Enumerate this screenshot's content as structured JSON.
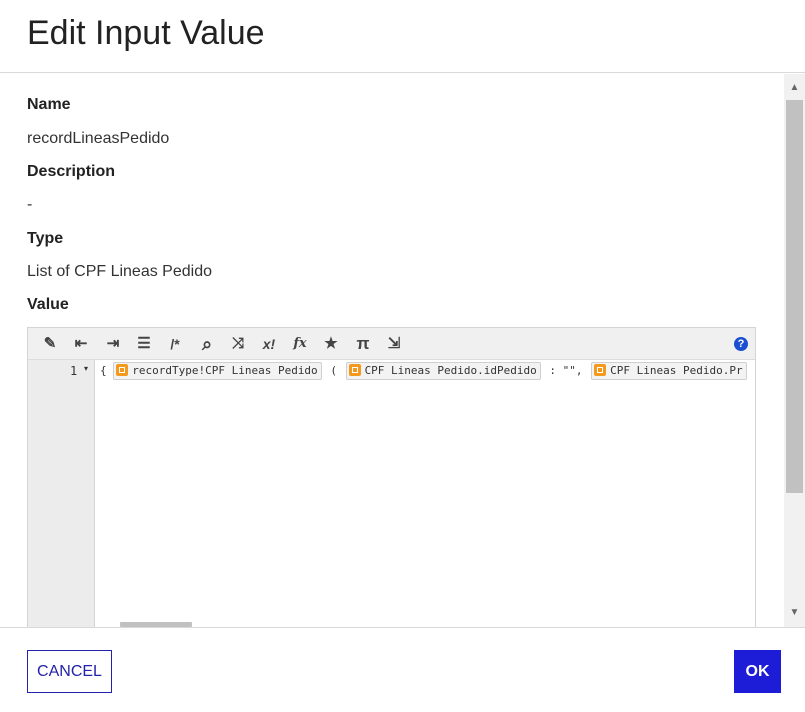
{
  "dialog": {
    "title": "Edit Input Value"
  },
  "fields": {
    "name_label": "Name",
    "name_value": "recordLineasPedido",
    "description_label": "Description",
    "description_value": "-",
    "type_label": "Type",
    "type_value": "List of CPF Lineas Pedido",
    "value_label": "Value"
  },
  "editor": {
    "toolbar": [
      {
        "name": "magic-wand-icon",
        "glyph": "✎"
      },
      {
        "name": "outdent-icon",
        "glyph": "⇤"
      },
      {
        "name": "indent-icon",
        "glyph": "⇥"
      },
      {
        "name": "format-icon",
        "glyph": "☰"
      },
      {
        "name": "comment-icon",
        "glyph": "/*"
      },
      {
        "name": "search-icon",
        "glyph": "⌕"
      },
      {
        "name": "shuffle-icon",
        "glyph": "⤨"
      },
      {
        "name": "expression-icon",
        "glyph": "x!"
      },
      {
        "name": "function-icon",
        "glyph": "fx"
      },
      {
        "name": "star-icon",
        "glyph": "★"
      },
      {
        "name": "pi-icon",
        "glyph": "π"
      },
      {
        "name": "export-icon",
        "glyph": "⇲"
      }
    ],
    "help_glyph": "?",
    "line_number": "1",
    "fold_glyph": "▾",
    "code": {
      "open_brace": "{",
      "token1": "recordType!CPF Lineas Pedido",
      "open_paren": "(",
      "token2": "CPF Lineas Pedido.idPedido",
      "colon_value": ": \"\",",
      "token3": "CPF Lineas Pedido.Pr"
    }
  },
  "footer": {
    "cancel_label": "CANCEL",
    "ok_label": "OK"
  },
  "colors": {
    "accent": "#1d1dd8",
    "token_icon": "#f39a1e"
  }
}
